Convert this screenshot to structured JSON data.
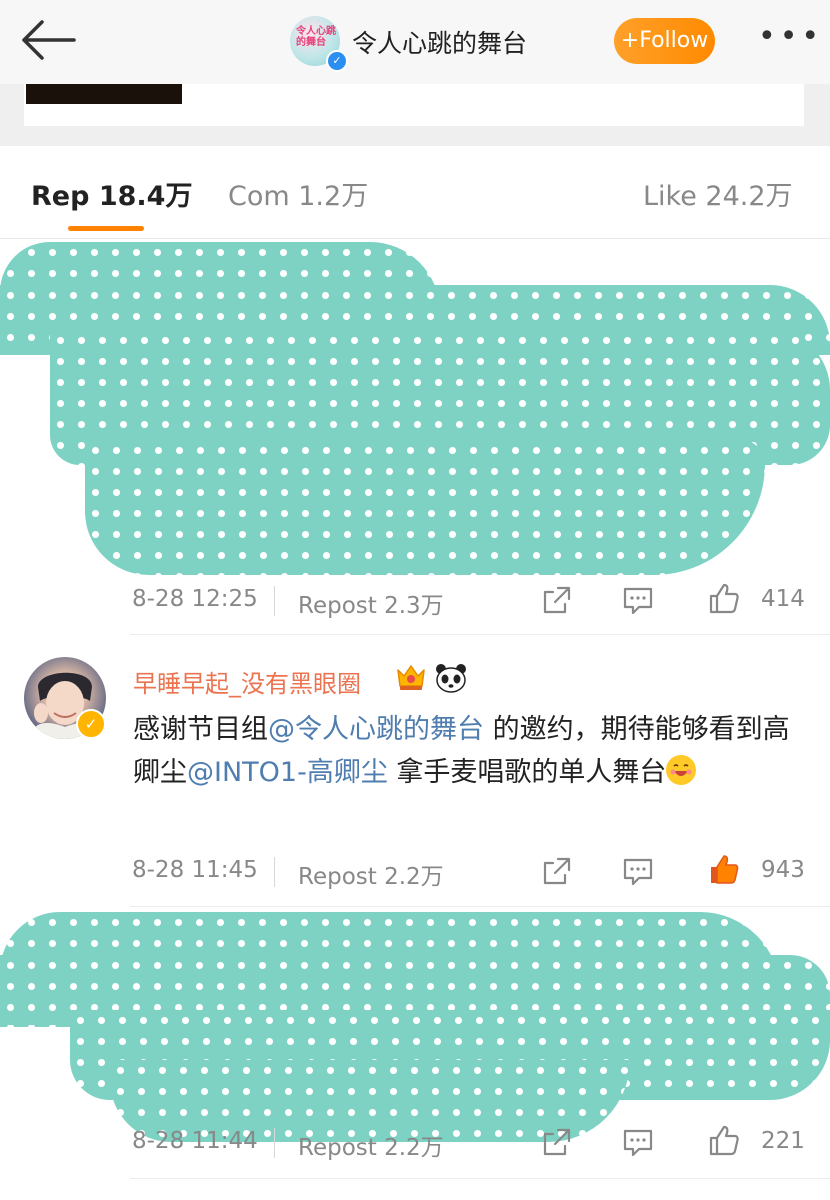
{
  "header": {
    "account_name": "令人心跳的舞台",
    "avatar_logo_text": "令人心跳的舞台",
    "follow_label": "+Follow",
    "more_label": "•••"
  },
  "tabs": {
    "repost": "Rep 18.4万",
    "comments": "Com 1.2万",
    "likes": "Like 24.2万"
  },
  "reposts": [
    {
      "time": "8-28 12:25",
      "repost": "Repost 2.3万",
      "likes": "414",
      "liked": false,
      "content_hidden": true
    },
    {
      "user": "早睡早起_没有黑眼圈",
      "text_parts": [
        "感谢节目组",
        "@令人心跳的舞台",
        " 的邀约，期待能够看到高卿尘",
        "@INTO1-高卿尘",
        " 拿手麦唱歌的单人舞台"
      ],
      "time": "8-28 11:45",
      "repost": "Repost 2.2万",
      "likes": "943",
      "liked": true
    },
    {
      "time": "8-28 11:44",
      "repost": "Repost 2.2万",
      "likes": "221",
      "liked": false,
      "content_hidden": true
    }
  ],
  "colors": {
    "accent": "#ff8200",
    "name": "#eb7350",
    "mention": "#507daf",
    "blob": "#7dd2c4"
  },
  "icons": [
    "back-arrow-icon",
    "verified-icon",
    "share-icon",
    "comment-icon",
    "thumbs-up-icon",
    "crown-badge-icon",
    "panda-icon",
    "grin-emoji-icon"
  ]
}
